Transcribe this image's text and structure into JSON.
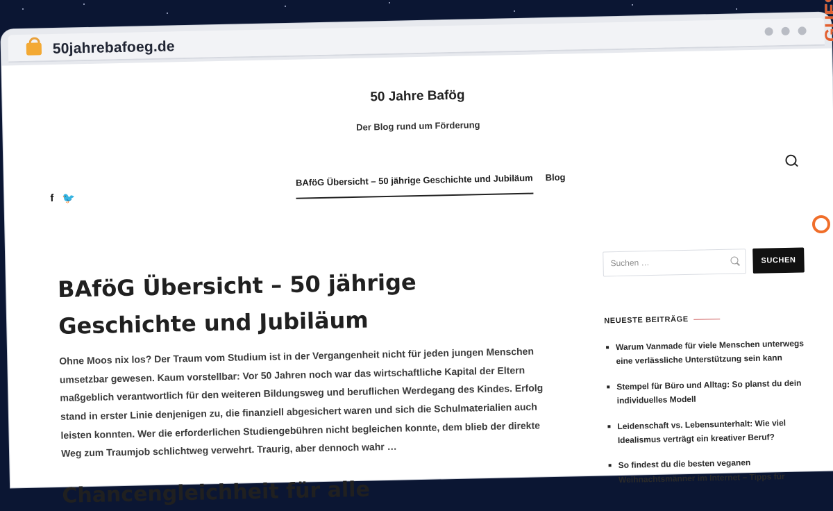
{
  "browser": {
    "url": "50jahrebafoeg.de"
  },
  "site": {
    "title": "50 Jahre Bafög",
    "tagline": "Der Blog rund um Förderung"
  },
  "nav": {
    "items": [
      {
        "label": "BAföG Übersicht – 50 jährige Geschichte und Jubiläum",
        "active": true
      },
      {
        "label": "Blog",
        "active": false
      }
    ]
  },
  "social": {
    "facebook": "f",
    "twitter": "🐦"
  },
  "post": {
    "title": "BAföG Übersicht – 50 jährige Geschichte und Jubiläum",
    "excerpt": "Ohne Moos nix los? Der Traum vom Studium ist in der Vergangenheit nicht für jeden jungen Menschen umsetzbar gewesen. Kaum vorstellbar: Vor 50 Jahren noch war das wirtschaftliche Kapital der Eltern maßgeblich verantwortlich für den weiteren Bildungsweg und beruflichen Werdegang des Kindes. Erfolg stand in erster Linie denjenigen zu, die finanziell abgesichert waren und sich die Schulmaterialien auch leisten konnten. Wer die erforderlichen Studiengebühren nicht begleichen konnte, dem blieb der direkte Weg zum Traumjob schlichtweg verwehrt. Traurig, aber dennoch wahr …",
    "next_heading": "Chancengleichheit für alle"
  },
  "sidebar": {
    "search_placeholder": "Suchen …",
    "search_button": "SUCHEN",
    "recent_title": "NEUESTE BEITRÄGE",
    "recent_posts": [
      "Warum Vanmade für viele Menschen unterwegs eine verlässliche Unterstützung sein kann",
      "Stempel für Büro und Alltag: So planst du dein individuelles Modell",
      "Leidenschaft vs. Lebensunterhalt: Wie viel Idealismus verträgt ein kreativer Beruf?",
      "So findest du die besten veganen Weihnachtsmänner im Internet – Tipps für"
    ]
  },
  "watermark": {
    "text": "GUESTPOSTLINKS"
  }
}
